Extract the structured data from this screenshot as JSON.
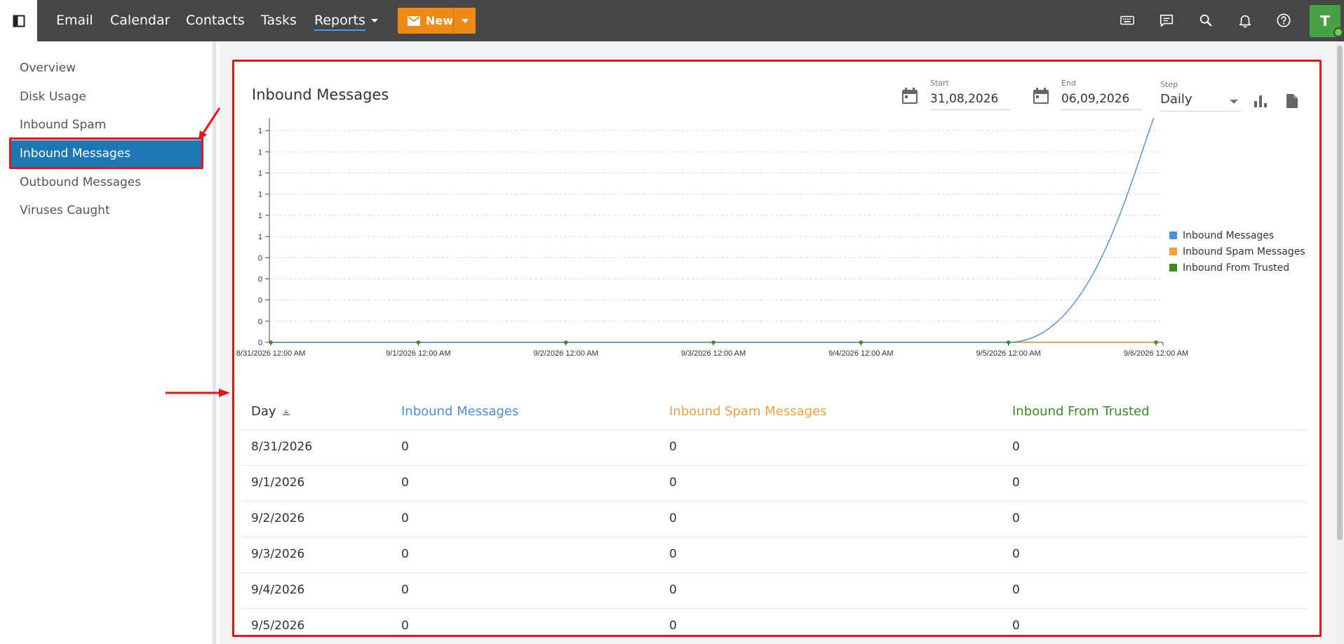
{
  "topbar": {
    "nav": [
      {
        "label": "Email"
      },
      {
        "label": "Calendar"
      },
      {
        "label": "Contacts"
      },
      {
        "label": "Tasks"
      },
      {
        "label": "Reports"
      }
    ],
    "new_button": {
      "label": "New"
    },
    "icons": [
      "keyboard-icon",
      "chat-icon",
      "search-icon",
      "bell-icon",
      "help-icon"
    ],
    "avatar_initial": "T",
    "accent_color": "#ef8a17",
    "avatar_color": "#46a244"
  },
  "sidebar": {
    "items": [
      {
        "label": "Overview"
      },
      {
        "label": "Disk Usage"
      },
      {
        "label": "Inbound Spam"
      },
      {
        "label": "Inbound Messages"
      },
      {
        "label": "Outbound Messages"
      },
      {
        "label": "Viruses Caught"
      }
    ],
    "active": "Inbound Messages",
    "active_color": "#1b78b4"
  },
  "report": {
    "title": "Inbound Messages",
    "start_label": "Start",
    "start_value": "31,08,2026",
    "end_label": "End",
    "end_value": "06,09,2026",
    "step_label": "Step",
    "step_value": "Daily"
  },
  "chart_data": {
    "type": "line",
    "title": "",
    "xlabel": "",
    "ylabel": "",
    "x": [
      "8/31/2026 12:00 AM",
      "9/1/2026 12:00 AM",
      "9/2/2026 12:00 AM",
      "9/3/2026 12:00 AM",
      "9/4/2026 12:00 AM",
      "9/5/2026 12:00 AM",
      "9/6/2026 12:00 AM"
    ],
    "y_tick_labels": [
      "0",
      "0",
      "0",
      "0",
      "0",
      "1",
      "1",
      "1",
      "1",
      "1",
      "1",
      "1"
    ],
    "ylim": [
      0,
      1.1
    ],
    "grid": true,
    "legend_position": "right",
    "series": [
      {
        "name": "Inbound Messages",
        "color": "#4a90d9",
        "values": [
          0,
          0,
          0,
          0,
          0,
          0,
          1
        ]
      },
      {
        "name": "Inbound Spam Messages",
        "color": "#f0a040",
        "values": [
          0,
          0,
          0,
          0,
          0,
          0,
          0
        ]
      },
      {
        "name": "Inbound From Trusted",
        "color": "#3a8a1e",
        "values": [
          0,
          0,
          0,
          0,
          0,
          0,
          0
        ]
      }
    ]
  },
  "table": {
    "columns": [
      {
        "label": "Day",
        "color": "#333333"
      },
      {
        "label": "Inbound Messages",
        "color": "#4a90d9"
      },
      {
        "label": "Inbound Spam Messages",
        "color": "#f0a040"
      },
      {
        "label": "Inbound From Trusted",
        "color": "#3a8a1e"
      }
    ],
    "rows": [
      [
        "8/31/2026",
        "0",
        "0",
        "0"
      ],
      [
        "9/1/2026",
        "0",
        "0",
        "0"
      ],
      [
        "9/2/2026",
        "0",
        "0",
        "0"
      ],
      [
        "9/3/2026",
        "0",
        "0",
        "0"
      ],
      [
        "9/4/2026",
        "0",
        "0",
        "0"
      ],
      [
        "9/5/2026",
        "0",
        "0",
        "0"
      ]
    ]
  }
}
